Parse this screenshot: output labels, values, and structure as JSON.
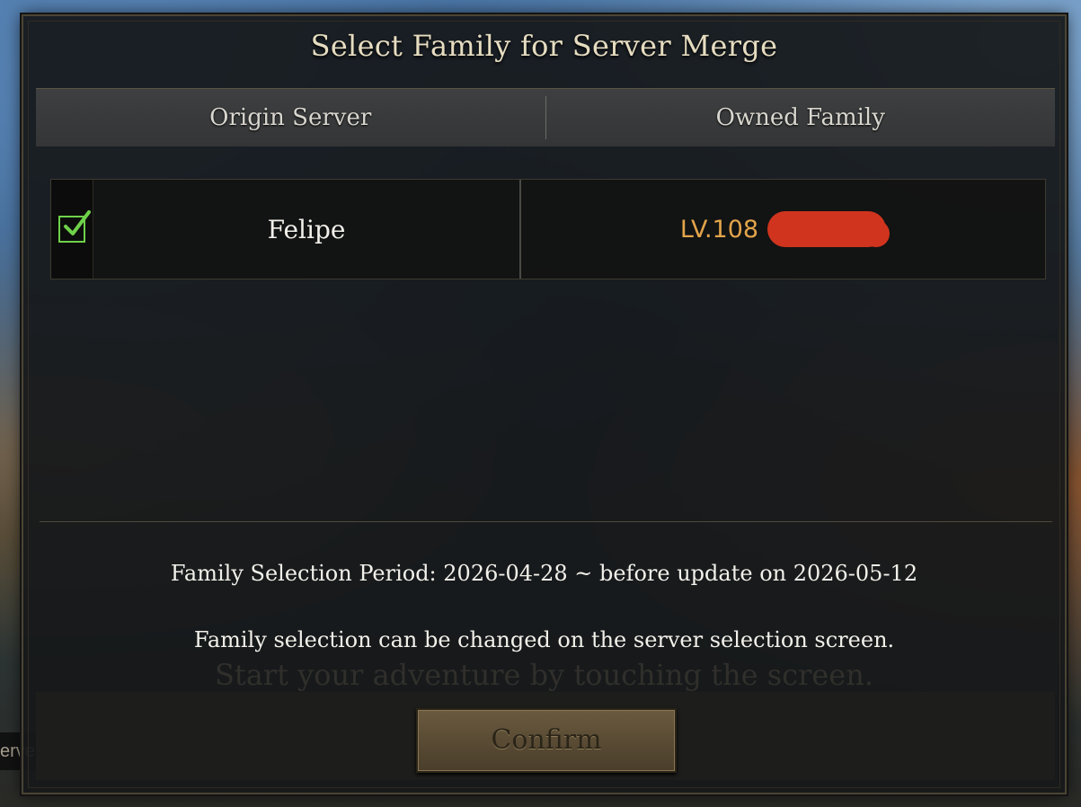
{
  "dialog": {
    "title": "Select Family for Server Merge",
    "columns": [
      "Origin Server",
      "Owned Family"
    ],
    "rows": [
      {
        "checked": true,
        "server": "Felipe",
        "family_level": "LV.108"
      }
    ],
    "info": {
      "period": "Family Selection Period: 2026-04-28 ~ before update on 2026-05-12",
      "note": "Family selection can be changed on the server selection screen."
    },
    "confirm_label": "Confirm"
  },
  "background": {
    "watermark": "Start your adventure by touching the screen.",
    "left_hint": "erve"
  },
  "colors": {
    "check": "#6fd14a",
    "level": "#e2a44a",
    "title": "#e6dcc0",
    "redaction": "#d0341e"
  },
  "icons": [
    "checkbox-checked-icon"
  ]
}
